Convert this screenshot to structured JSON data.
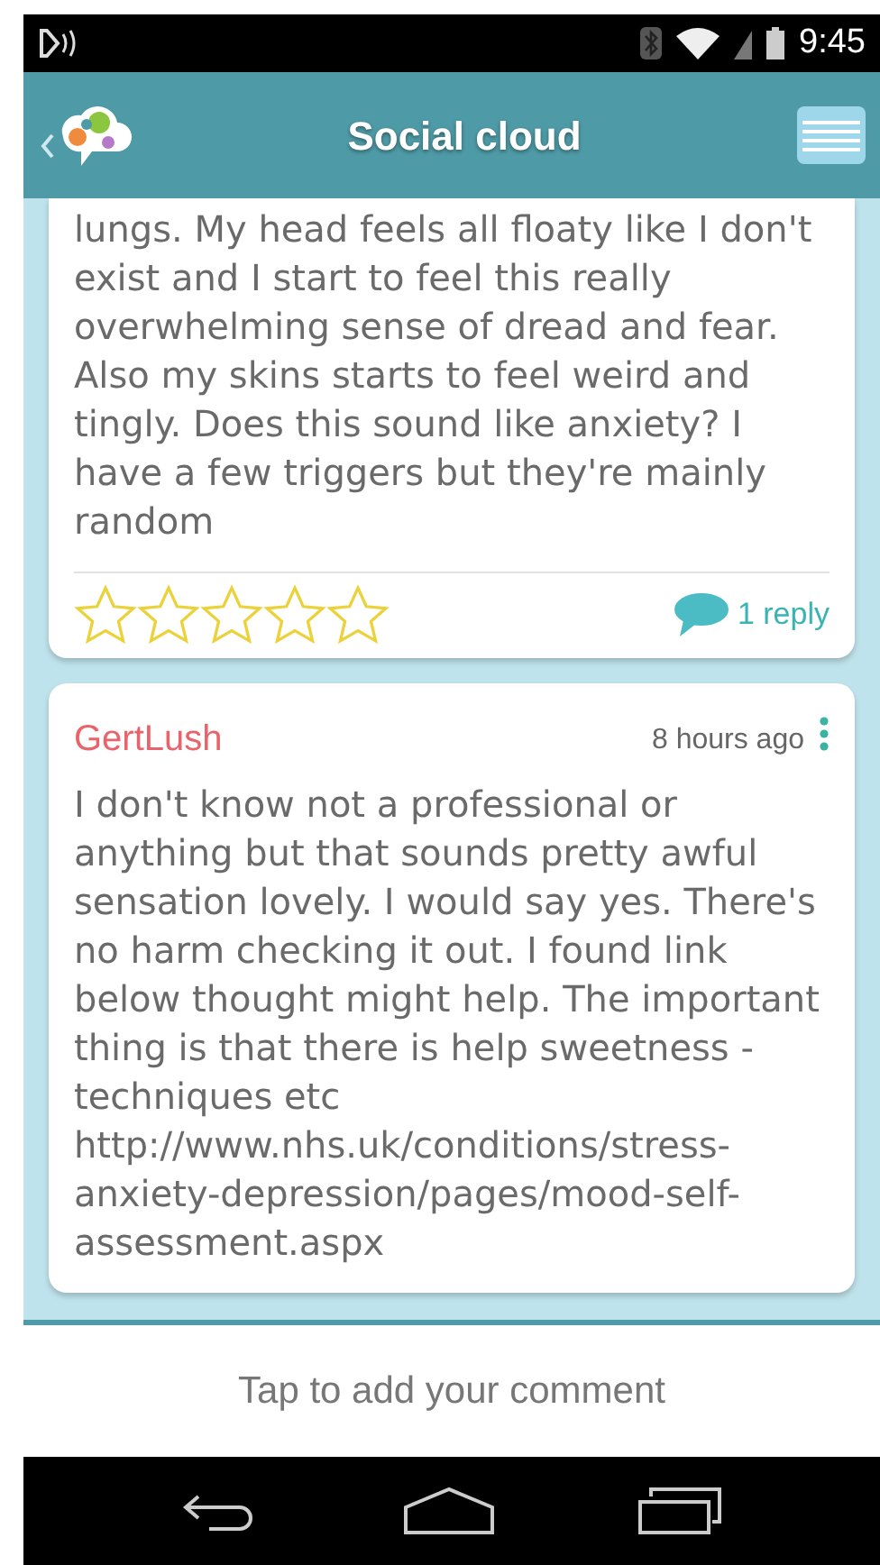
{
  "status_bar": {
    "time": "9:45"
  },
  "header": {
    "title": "Social cloud"
  },
  "posts": [
    {
      "body": "lungs. My head feels all floaty like I don't exist and I start to feel this really overwhelming sense of dread and fear. Also my skins starts to feel weird and tingly. Does this sound like anxiety? I have a few triggers but they're mainly random",
      "stars": 0,
      "replies": "1 reply"
    },
    {
      "author": "GertLush",
      "time": "8 hours ago",
      "body": "I don't know not a professional or anything but that sounds pretty awful sensation lovely. I would say yes. There's no harm checking it out. I found link below thought might help. The important thing is that there is help sweetness - techniques etc http://www.nhs.uk/conditions/stress-anxiety-depression/pages/mood-self-assessment.aspx"
    }
  ],
  "comment_bar": {
    "placeholder": "Tap to add your comment"
  }
}
